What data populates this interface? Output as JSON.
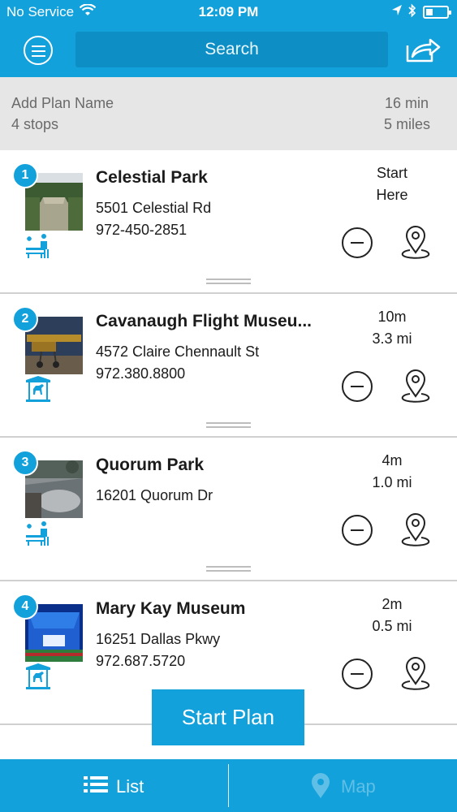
{
  "status_bar": {
    "carrier": "No Service",
    "time": "12:09 PM"
  },
  "header": {
    "search_label": "Search",
    "menu_icon": "hamburger-circle-icon",
    "share_icon": "share-arrow-icon"
  },
  "plan": {
    "name_placeholder": "Add Plan Name",
    "stops_count": "4 stops",
    "total_time": "16 min",
    "total_distance": "5 miles"
  },
  "stops": [
    {
      "number": "1",
      "name": "Celestial Park",
      "address": "5501 Celestial Rd",
      "phone": "972-450-2851",
      "line1": "Start",
      "line2": "Here",
      "category_icon": "park-bench-icon"
    },
    {
      "number": "2",
      "name": "Cavanaugh Flight Museu...",
      "address": "4572 Claire Chennault St",
      "phone": "972.380.8800",
      "line1": "10m",
      "line2": "3.3 mi",
      "category_icon": "carousel-horse-icon"
    },
    {
      "number": "3",
      "name": "Quorum Park",
      "address": "16201 Quorum Dr",
      "phone": "",
      "line1": "4m",
      "line2": "1.0 mi",
      "category_icon": "park-bench-icon"
    },
    {
      "number": "4",
      "name": "Mary Kay Museum",
      "address": "16251 Dallas Pkwy",
      "phone": "972.687.5720",
      "line1": "2m",
      "line2": "0.5 mi",
      "category_icon": "carousel-horse-icon"
    }
  ],
  "actions": {
    "start_plan_label": "Start Plan"
  },
  "tabs": {
    "list_label": "List",
    "map_label": "Map"
  },
  "colors": {
    "primary": "#13a1dc",
    "search_bg": "#0d8fc6",
    "summary_bg": "#e6e6e6",
    "inactive_tab": "#5fbfe6"
  }
}
